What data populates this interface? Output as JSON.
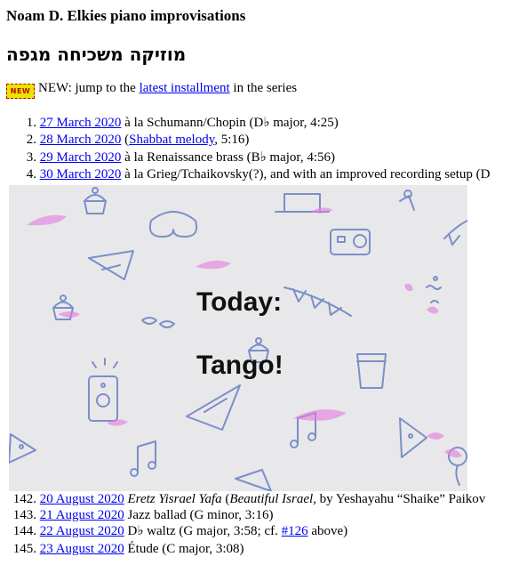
{
  "header": {
    "title": "Noam D. Elkies piano improvisations",
    "hebrew_title": "מוזיקה משכיחה מגפה"
  },
  "news": {
    "badge": "NEW",
    "prefix": "NEW: jump to the ",
    "link": "latest installment",
    "suffix": " in the series"
  },
  "top_list": [
    {
      "num": "1.",
      "date": "27 March 2020",
      "desc": " à la Schumann/Chopin (D♭ major, 4:25)"
    },
    {
      "num": "2.",
      "date": "28 March 2020",
      "desc_pre": " (",
      "desc_link": "Shabbat melody",
      "desc_post": ", 5:16)"
    },
    {
      "num": "3.",
      "date": "29 March 2020",
      "desc": " à la Renaissance brass (B♭ major, 4:56)"
    },
    {
      "num": "4.",
      "date": "30 March 2020",
      "desc": " à la Grieg/Tchaikovsky(?), and with an improved recording setup (D"
    }
  ],
  "overlay": {
    "line1": "Today:",
    "line2": "Tango!"
  },
  "bottom_list": [
    {
      "num": "142.",
      "date": "20 August 2020",
      "desc_ital": "Eretz Yisrael Yafa",
      "desc_mid": " (",
      "desc_ital2": "Beautiful Israel",
      "desc_post": ", by Yeshayahu “Shaike” Paikov"
    },
    {
      "num": "143.",
      "date": "21 August 2020",
      "desc": " Jazz ballad (G minor, 3:16)"
    },
    {
      "num": "144.",
      "date": "22 August 2020",
      "desc_pre": " D♭ waltz (G major, 3:58; cf. ",
      "desc_link": "#126",
      "desc_post": " above)"
    },
    {
      "num": "145.",
      "date": "23 August 2020",
      "desc": " Étude (C major, 3:08)"
    }
  ],
  "colors": {
    "link": "#0000ee",
    "overlay_bg": "#e8e8ea",
    "doodle_blue": "#7b8fc9",
    "doodle_pink": "#e37be0"
  }
}
